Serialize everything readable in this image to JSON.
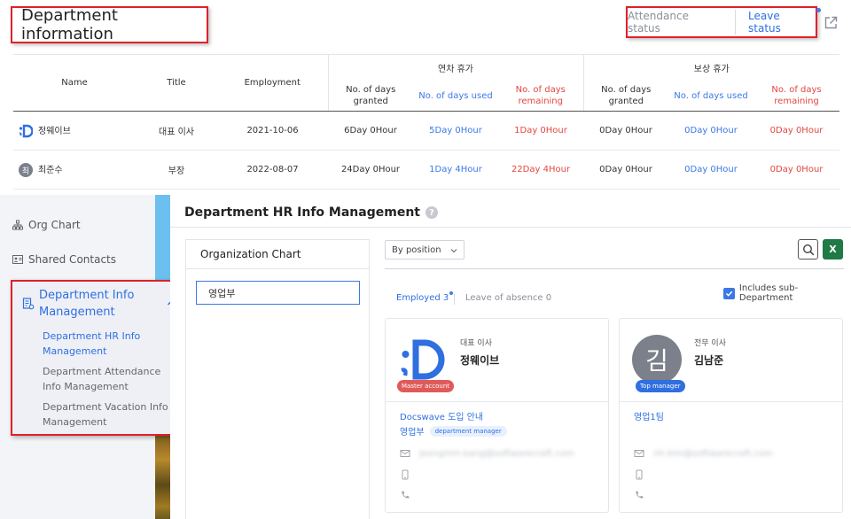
{
  "header": {
    "title": "Department information",
    "attendance_status": "Attendance status",
    "leave_status": "Leave status"
  },
  "leave_table": {
    "headers": {
      "name": "Name",
      "title": "Title",
      "employment": "Employment",
      "annual_group": "연차 휴가",
      "comp_group": "보상 휴가",
      "granted": "No. of days granted",
      "used": "No. of days used",
      "remaining": "No. of days remaining"
    },
    "rows": [
      {
        "avatar_text": ";D",
        "name": "정웨이브",
        "title": "대표 이사",
        "employment": "2021-10-06",
        "annual_granted": "6Day 0Hour",
        "annual_used": "5Day 0Hour",
        "annual_remaining": "1Day 0Hour",
        "comp_granted": "0Day 0Hour",
        "comp_used": "0Day 0Hour",
        "comp_remaining": "0Day 0Hour"
      },
      {
        "avatar_text": "최",
        "name": "최준수",
        "title": "부장",
        "employment": "2022-08-07",
        "annual_granted": "24Day 0Hour",
        "annual_used": "1Day 4Hour",
        "annual_remaining": "22Day 4Hour",
        "comp_granted": "0Day 0Hour",
        "comp_used": "0Day 0Hour",
        "comp_remaining": "0Day 0Hour"
      }
    ]
  },
  "sidebar": {
    "org_chart": "Org Chart",
    "shared_contacts": "Shared Contacts",
    "dept_info_mgmt": "Department Info Management",
    "sub_items": [
      "Department HR Info Management",
      "Department Attendance Info Management",
      "Department Vacation Info Management"
    ]
  },
  "main": {
    "title": "Department HR Info Management",
    "help": "?",
    "org_panel_title": "Organization Chart",
    "org_node": "영업부",
    "filter_value": "By position",
    "excel_label": "X",
    "tab_employed": "Employed 3",
    "tab_leave": "Leave of absence 0",
    "includes_sub": "Includes sub-Department"
  },
  "cards": [
    {
      "avatar_text": ";D",
      "badge": "Master account",
      "title": "대표 이사",
      "name": "정웨이브",
      "link": "Docswave 도입 안내",
      "dept": "영업부",
      "dept_pill": "department manager",
      "email": "jeongmin.kang@softwarecraft.com"
    },
    {
      "avatar_text": "김",
      "badge": "Top manager",
      "title": "전무 이사",
      "name": "김남준",
      "link": "영업1팀",
      "email": "nh.kim@softwarecraft.com"
    }
  ],
  "colors": {
    "accent_blue": "#2f6fe0",
    "remaining_red": "#e2473f",
    "highlight_red": "#e0202a",
    "master_badge": "#e05a5a",
    "top_manager_badge": "#2f6fe0",
    "excel_green": "#1f7a45"
  },
  "icons": {
    "popout": "external-link-icon",
    "org_chart": "org-chart-icon",
    "shared_contacts": "contacts-icon",
    "dept_info": "department-icon",
    "search": "search-icon",
    "email": "mail-icon",
    "mobile": "mobile-icon",
    "phone": "phone-icon"
  }
}
